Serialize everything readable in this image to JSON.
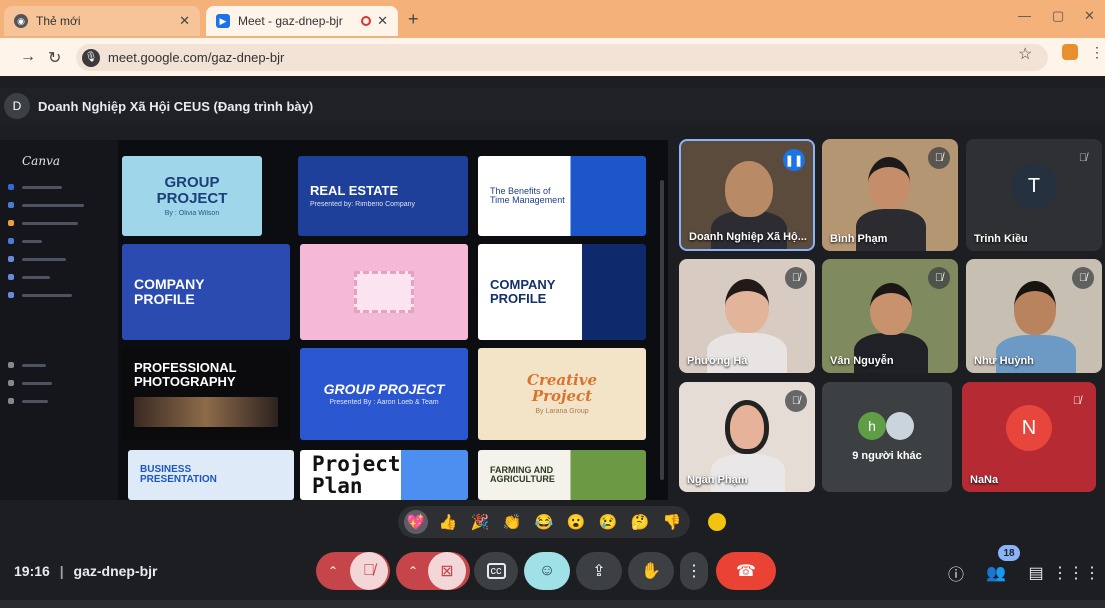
{
  "browser": {
    "tabs": [
      {
        "label": "Thẻ mới",
        "icon": "chrome-icon"
      },
      {
        "label": "Meet - gaz-dnep-bjr",
        "icon": "meet-icon",
        "recording": true
      }
    ],
    "url": "meet.google.com/gaz-dnep-bjr"
  },
  "meeting": {
    "presenter_initial": "D",
    "presenter_title": "Doanh Nghiệp Xã Hội CEUS (Đang trình bày)",
    "time": "19:16",
    "code": "gaz-dnep-bjr",
    "people_count": "18"
  },
  "presentation": {
    "app": "Canva",
    "templates": [
      {
        "title": "GROUP PROJECT",
        "sub": "By : Olivia Wilson"
      },
      {
        "title": "REAL ESTATE",
        "sub": "Presented by: Rimberio Company"
      },
      {
        "title": "The Benefits of Time Management",
        "sub": ""
      },
      {
        "title": "COMPANY PROFILE",
        "sub": ""
      },
      {
        "title": "",
        "sub": ""
      },
      {
        "title": "COMPANY PROFILE",
        "sub": ""
      },
      {
        "title": "PROFESSIONAL PHOTOGRAPHY",
        "sub": ""
      },
      {
        "title": "GROUP PROJECT",
        "sub": "Presented By : Aaron Loeb & Team"
      },
      {
        "title": "Creative Project",
        "sub": "By Larana Group"
      },
      {
        "title": "BUSINESS PRESENTATION",
        "sub": ""
      },
      {
        "title": "Project Plan",
        "sub": ""
      },
      {
        "title": "FARMING AND AGRICULTURE",
        "sub": ""
      }
    ]
  },
  "participants": [
    {
      "name": "Doanh Nghiệp Xã Hộ...",
      "speaking": true
    },
    {
      "name": "Bình Phạm",
      "muted": true
    },
    {
      "name": "Trinh Kiều",
      "initial": "T",
      "muted": true
    },
    {
      "name": "Phương Hà",
      "muted": true
    },
    {
      "name": "Vân Nguyễn",
      "muted": true
    },
    {
      "name": "Như Huỳnh",
      "muted": true
    },
    {
      "name": "Ngân Phạm",
      "muted": true
    },
    {
      "name": "9 người khác",
      "initial": "h"
    },
    {
      "name": "NaNa",
      "initial": "N",
      "muted": true
    }
  ],
  "reactions": [
    "💖",
    "👍",
    "🎉",
    "👏",
    "😂",
    "😮",
    "😢",
    "🤔",
    "👎"
  ],
  "colors": {
    "accent_blue": "#8ab4f8",
    "end_call_red": "#ea4335",
    "muted_btn_red": "#c5454a",
    "reaction_btn_teal": "#9fe1e6",
    "meet_bg": "#1d1e21"
  }
}
